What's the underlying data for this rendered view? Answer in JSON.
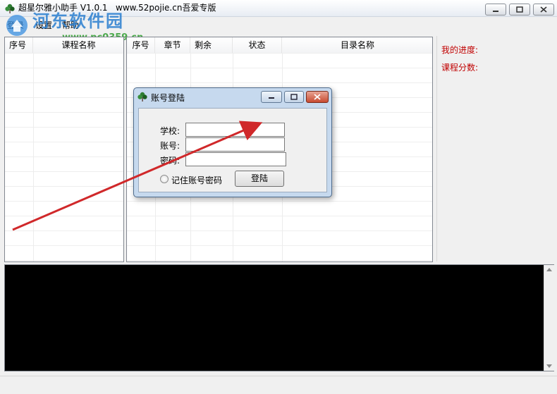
{
  "window": {
    "title": "超星尔雅小助手 V1.0.1   www.52pojie.cn吾爱专版",
    "icon": "clover-icon"
  },
  "watermark": {
    "text": "河东软件园",
    "url": "www.pc0359.cn"
  },
  "menu": {
    "items": [
      "登录",
      "设置",
      "帮助"
    ]
  },
  "course_list": {
    "columns": [
      "序号",
      "课程名称"
    ]
  },
  "chapter_list": {
    "columns": [
      "序号",
      "章节",
      "剩余",
      "状态",
      "目录名称"
    ]
  },
  "progress_panel": {
    "my_progress_label": "我的进度:",
    "course_score_label": "课程分数:"
  },
  "login_dialog": {
    "title": "账号登陆",
    "school_label": "学校:",
    "account_label": "账号:",
    "password_label": "密码:",
    "school_value": "",
    "account_value": "",
    "password_value": "",
    "remember_label": "记住账号密码",
    "remember_checked": false,
    "login_button": "登陆"
  },
  "colors": {
    "accent_red": "#c00000",
    "arrow": "#d0282a",
    "log_background": "#000000"
  }
}
